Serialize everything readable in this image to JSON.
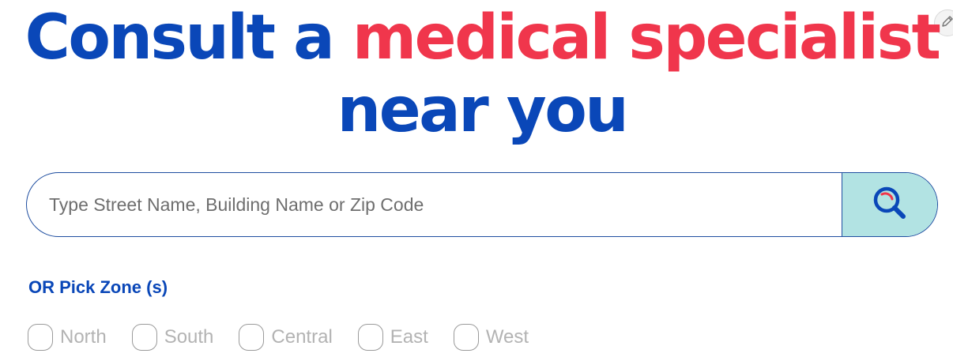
{
  "headline": {
    "part1": "Consult a ",
    "accent": "medical specialist",
    "line2": "near you"
  },
  "search": {
    "placeholder": "Type Street Name, Building Name or Zip Code",
    "button_icon": "search-icon"
  },
  "edit_icon": "pencil-icon",
  "zones": {
    "label": "OR Pick Zone (s)",
    "options": [
      {
        "label": "North",
        "checked": false
      },
      {
        "label": "South",
        "checked": false
      },
      {
        "label": "Central",
        "checked": false
      },
      {
        "label": "East",
        "checked": false
      },
      {
        "label": "West",
        "checked": false
      }
    ]
  },
  "colors": {
    "primary_blue": "#0a47b8",
    "accent_red": "#f0364c",
    "search_button_bg": "#b2e3e3"
  }
}
